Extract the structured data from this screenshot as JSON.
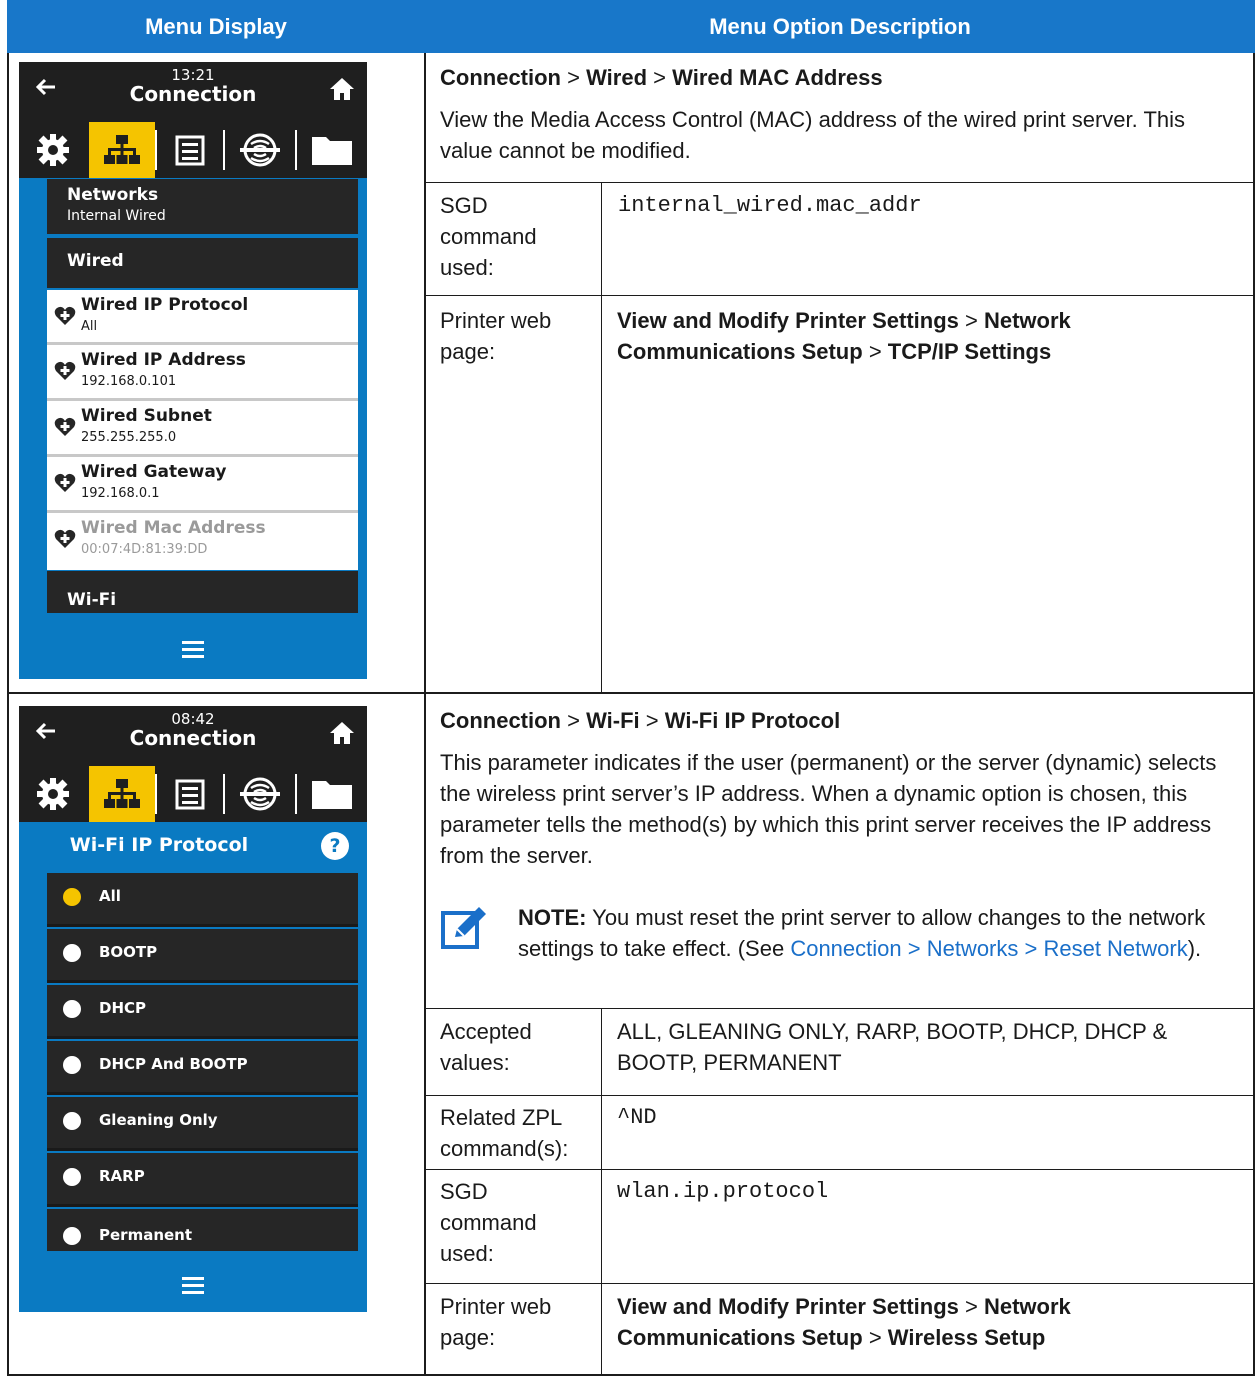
{
  "header": {
    "col1": "Menu Display",
    "col2": "Menu Option Description"
  },
  "screen1": {
    "time": "13:21",
    "title": "Connection",
    "networks": {
      "title": "Networks",
      "sub": "Internal Wired"
    },
    "section": "Wired",
    "items": [
      {
        "title": "Wired IP Protocol",
        "value": "All"
      },
      {
        "title": "Wired IP Address",
        "value": "192.168.0.101"
      },
      {
        "title": "Wired Subnet",
        "value": "255.255.255.0"
      },
      {
        "title": "Wired Gateway",
        "value": "192.168.0.1"
      },
      {
        "title": "Wired Mac Address",
        "value": "00:07:4D:81:39:DD"
      }
    ],
    "next_section": "Wi-Fi",
    "icons": [
      "back-arrow-icon",
      "home-icon",
      "settings-gear-icon",
      "network-icon",
      "printer-icon",
      "rfid-icon",
      "folder-icon",
      "menu-icon",
      "heart-plus-icon"
    ]
  },
  "desc1": {
    "path": [
      "Connection",
      "Wired",
      "Wired MAC Address"
    ],
    "sep": ">",
    "text": "View the Media Access Control (MAC) address of the wired print server. This value cannot be modified.",
    "rows": [
      {
        "label": "SGD command used:",
        "value": "internal_wired.mac_addr"
      },
      {
        "label": "Printer web page:",
        "value_parts": [
          "View and Modify Printer Settings",
          "Network Communications Setup",
          "TCP/IP Settings"
        ]
      }
    ]
  },
  "screen2": {
    "time": "08:42",
    "title": "Connection",
    "heading": "Wi-Fi IP Protocol",
    "help": "?",
    "options": [
      {
        "label": "All",
        "selected": true
      },
      {
        "label": "BOOTP",
        "selected": false
      },
      {
        "label": "DHCP",
        "selected": false
      },
      {
        "label": "DHCP And BOOTP",
        "selected": false
      },
      {
        "label": "Gleaning Only",
        "selected": false
      },
      {
        "label": "RARP",
        "selected": false
      },
      {
        "label": "Permanent",
        "selected": false
      }
    ]
  },
  "desc2": {
    "path": [
      "Connection",
      "Wi-Fi",
      "Wi-Fi IP Protocol"
    ],
    "sep": ">",
    "text": "This parameter indicates if the user (permanent) or the server (dynamic) selects the wireless print server’s IP address. When a dynamic option is chosen, this parameter tells the method(s) by which this print server receives the IP address from the server.",
    "note_label": "NOTE:",
    "note_text": "You must reset the print server to allow changes to the network settings to take effect. (See",
    "note_link": "Connection > Networks > Reset Network",
    "note_end": ").",
    "rows": [
      {
        "label": "Accepted values:",
        "value": "ALL, GLEANING ONLY, RARP, BOOTP, DHCP, DHCP & BOOTP, PERMANENT"
      },
      {
        "label": "Related ZPL command(s):",
        "value": "^ND"
      },
      {
        "label": "SGD command used:",
        "value": "wlan.ip.protocol"
      },
      {
        "label": "Printer web page:",
        "value_parts": [
          "View and Modify Printer Settings",
          "Network Communications Setup",
          "Wireless Setup"
        ]
      }
    ]
  },
  "colors": {
    "header": "#1877c9",
    "screen_bg": "#0a7ac2",
    "selected_tab": "#f5c400",
    "dark_row": "#262626",
    "link": "#1a6fc9"
  }
}
